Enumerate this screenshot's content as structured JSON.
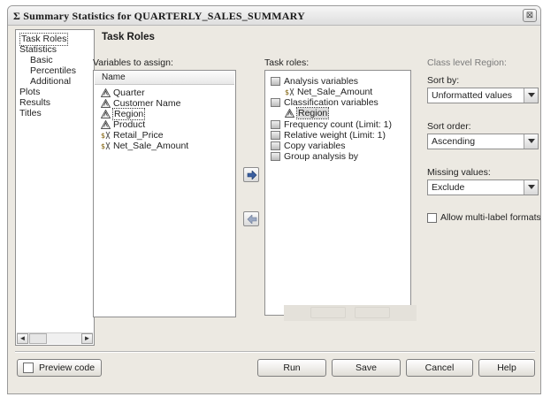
{
  "window": {
    "title": "Σ Summary Statistics for QUARTERLY_SALES_SUMMARY",
    "close_glyph": "⊠"
  },
  "nav": {
    "items": [
      {
        "label": "Task Roles",
        "indent": 0,
        "selected": true
      },
      {
        "label": "Statistics",
        "indent": 0
      },
      {
        "label": "Basic",
        "indent": 1
      },
      {
        "label": "Percentiles",
        "indent": 1
      },
      {
        "label": "Additional",
        "indent": 1
      },
      {
        "label": "Plots",
        "indent": 0
      },
      {
        "label": "Results",
        "indent": 0
      },
      {
        "label": "Titles",
        "indent": 0
      }
    ],
    "scroll_left": "◄",
    "scroll_right": "►"
  },
  "main": {
    "title": "Task Roles"
  },
  "variables": {
    "label": "Variables to assign:",
    "column_header": "Name",
    "items": [
      {
        "name": "Quarter",
        "type": "character",
        "selected": false
      },
      {
        "name": "Customer Name",
        "type": "character",
        "selected": false
      },
      {
        "name": "Region",
        "type": "character",
        "selected": true
      },
      {
        "name": "Product",
        "type": "character",
        "selected": false
      },
      {
        "name": "Retail_Price",
        "type": "numeric",
        "selected": false
      },
      {
        "name": "Net_Sale_Amount",
        "type": "numeric",
        "selected": false
      }
    ]
  },
  "task_roles": {
    "label": "Task roles:",
    "items": [
      {
        "label": "Analysis variables",
        "kind": "role",
        "icon": "analysis-icon"
      },
      {
        "label": "Net_Sale_Amount",
        "kind": "assigned-numeric"
      },
      {
        "label": "Classification variables",
        "kind": "role",
        "icon": "classification-icon"
      },
      {
        "label": "Region",
        "kind": "assigned-character",
        "selected": true
      },
      {
        "label": "Frequency count  (Limit: 1)",
        "kind": "role",
        "icon": "frequency-icon"
      },
      {
        "label": "Relative weight  (Limit: 1)",
        "kind": "role",
        "icon": "weight-icon"
      },
      {
        "label": "Copy variables",
        "kind": "role",
        "icon": "copy-icon"
      },
      {
        "label": "Group analysis by",
        "kind": "role",
        "icon": "group-icon"
      }
    ]
  },
  "class_level": {
    "heading": "Class level Region:",
    "sort_by_label": "Sort by:",
    "sort_by_value": "Unformatted values",
    "sort_order_label": "Sort order:",
    "sort_order_value": "Ascending",
    "missing_label": "Missing values:",
    "missing_value": "Exclude",
    "multilabel_label": "Allow multi-label formats",
    "multilabel_checked": false
  },
  "buttons": {
    "preview_code": "Preview code",
    "run": "Run",
    "save": "Save",
    "cancel": "Cancel",
    "help": "Help"
  }
}
